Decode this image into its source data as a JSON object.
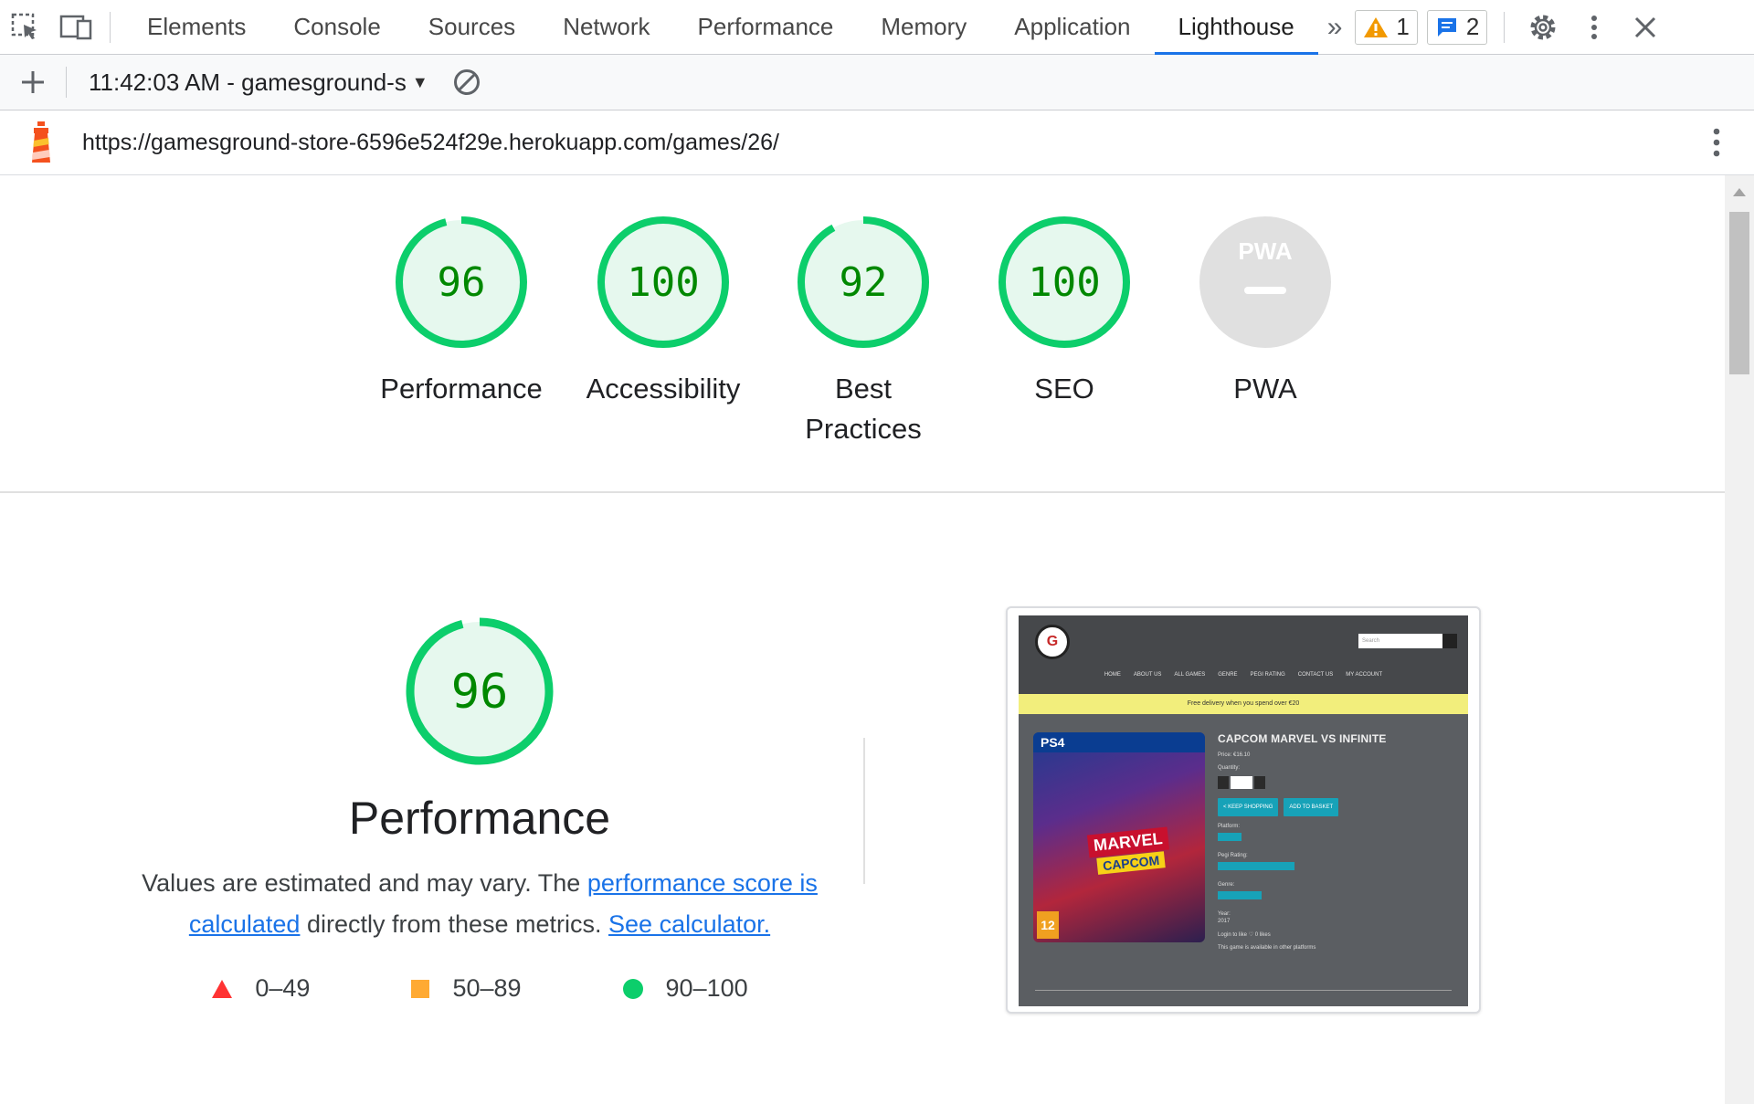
{
  "devtools": {
    "tabs": [
      "Elements",
      "Console",
      "Sources",
      "Network",
      "Performance",
      "Memory",
      "Application",
      "Lighthouse"
    ],
    "active_tab": "Lighthouse",
    "warning_count": "1",
    "message_count": "2"
  },
  "lighthouse_toolbar": {
    "report_label": "11:42:03 AM - gamesground-s"
  },
  "url_row": {
    "url": "https://gamesground-store-6596e524f29e.herokuapp.com/games/26/"
  },
  "categories": [
    {
      "label": "Performance",
      "score": "96",
      "value": 0.96
    },
    {
      "label": "Accessibility",
      "score": "100",
      "value": 1.0
    },
    {
      "label_line1": "Best",
      "label_line2": "Practices",
      "score": "92",
      "value": 0.92
    },
    {
      "label": "SEO",
      "score": "100",
      "value": 1.0
    },
    {
      "label": "PWA",
      "badge": "PWA",
      "score": "—"
    }
  ],
  "performance_section": {
    "score": "96",
    "title": "Performance",
    "desc_prefix": "Values are estimated and may vary. The ",
    "link1": "performance score is calculated",
    "desc_mid": " directly from these metrics. ",
    "link2": "See calculator.",
    "legend": [
      {
        "range": "0–49",
        "shape": "triangle",
        "color": "#ff3333"
      },
      {
        "range": "50–89",
        "shape": "square",
        "color": "#ffaa33"
      },
      {
        "range": "90–100",
        "shape": "circle",
        "color": "#0cce6b"
      }
    ]
  },
  "colors": {
    "pass": "#0cce6b",
    "pass_fill": "#e6f8ee",
    "pass_text": "#008800",
    "pwa_gray": "#e0e0e0",
    "accent": "#1a73e8"
  },
  "screenshot": {
    "search_placeholder": "Search",
    "nav": [
      "HOME",
      "ABOUT US",
      "ALL GAMES",
      "GENRE",
      "PEGI RATING",
      "CONTACT US",
      "MY ACCOUNT"
    ],
    "banner": "Free delivery when you spend over €20",
    "cover_platform": "PS4",
    "cover_marvel": "MARVEL",
    "cover_capcom": "CAPCOM",
    "cover_age": "12",
    "game_title": "CAPCOM MARVEL VS INFINITE",
    "price": "Price: €16.10",
    "quantity_label": "Quantity:",
    "keep_shopping": "< KEEP SHOPPING",
    "add_to_basket": "ADD TO BASKET",
    "platform_label": "Platform:",
    "pegi_label": "Pegi Rating:",
    "genre_label": "Genre:",
    "year_label": "Year:",
    "year": "2017",
    "likes": "Login to like  ♡ 0 likes",
    "platforms_note": "This game is available in other platforms"
  }
}
